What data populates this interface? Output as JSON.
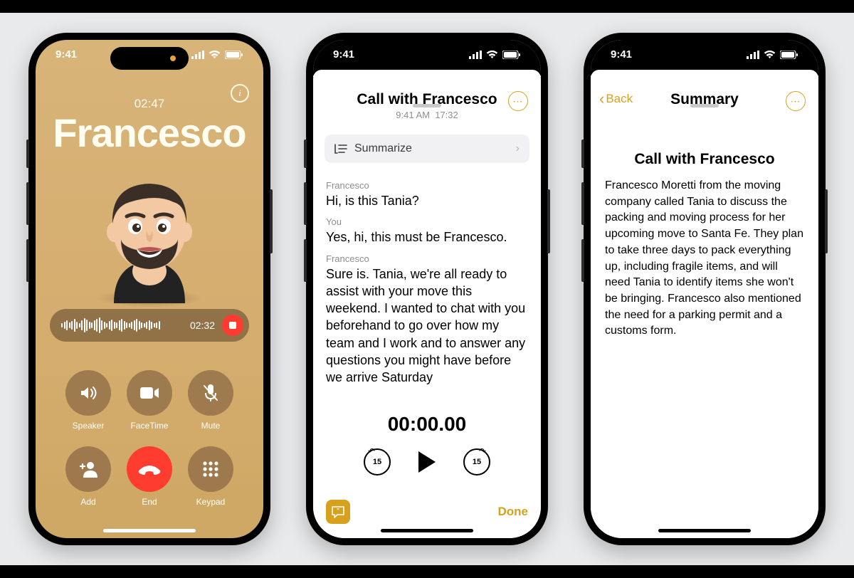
{
  "status": {
    "time": "9:41"
  },
  "phone1": {
    "duration": "02:47",
    "caller": "Francesco",
    "recording_time": "02:32",
    "controls": {
      "speaker": "Speaker",
      "facetime": "FaceTime",
      "mute": "Mute",
      "add": "Add",
      "end": "End",
      "keypad": "Keypad"
    }
  },
  "phone2": {
    "title": "Call with Francesco",
    "subtitle_time": "9:41 AM",
    "subtitle_dur": "17:32",
    "summarize_label": "Summarize",
    "transcript": [
      {
        "speaker": "Francesco",
        "text": "Hi, is this Tania?"
      },
      {
        "speaker": "You",
        "text": "Yes, hi, this must be Francesco."
      },
      {
        "speaker": "Francesco",
        "text": "Sure is. Tania, we're all ready to assist with your move this weekend. I wanted to chat with you beforehand to go over how my team and I work and to answer any questions you might have before we arrive Saturday"
      }
    ],
    "player_time": "00:00.00",
    "skip_amount": "15",
    "done_label": "Done"
  },
  "phone3": {
    "back_label": "Back",
    "header": "Summary",
    "title": "Call with Francesco",
    "body": "Francesco Moretti from the moving company called Tania to discuss the packing and moving process for her upcoming move to Santa Fe. They plan to take three days to pack everything up, including fragile items, and will need Tania to identify items she won't be bringing. Francesco also mentioned the need for a parking permit and a customs form."
  }
}
